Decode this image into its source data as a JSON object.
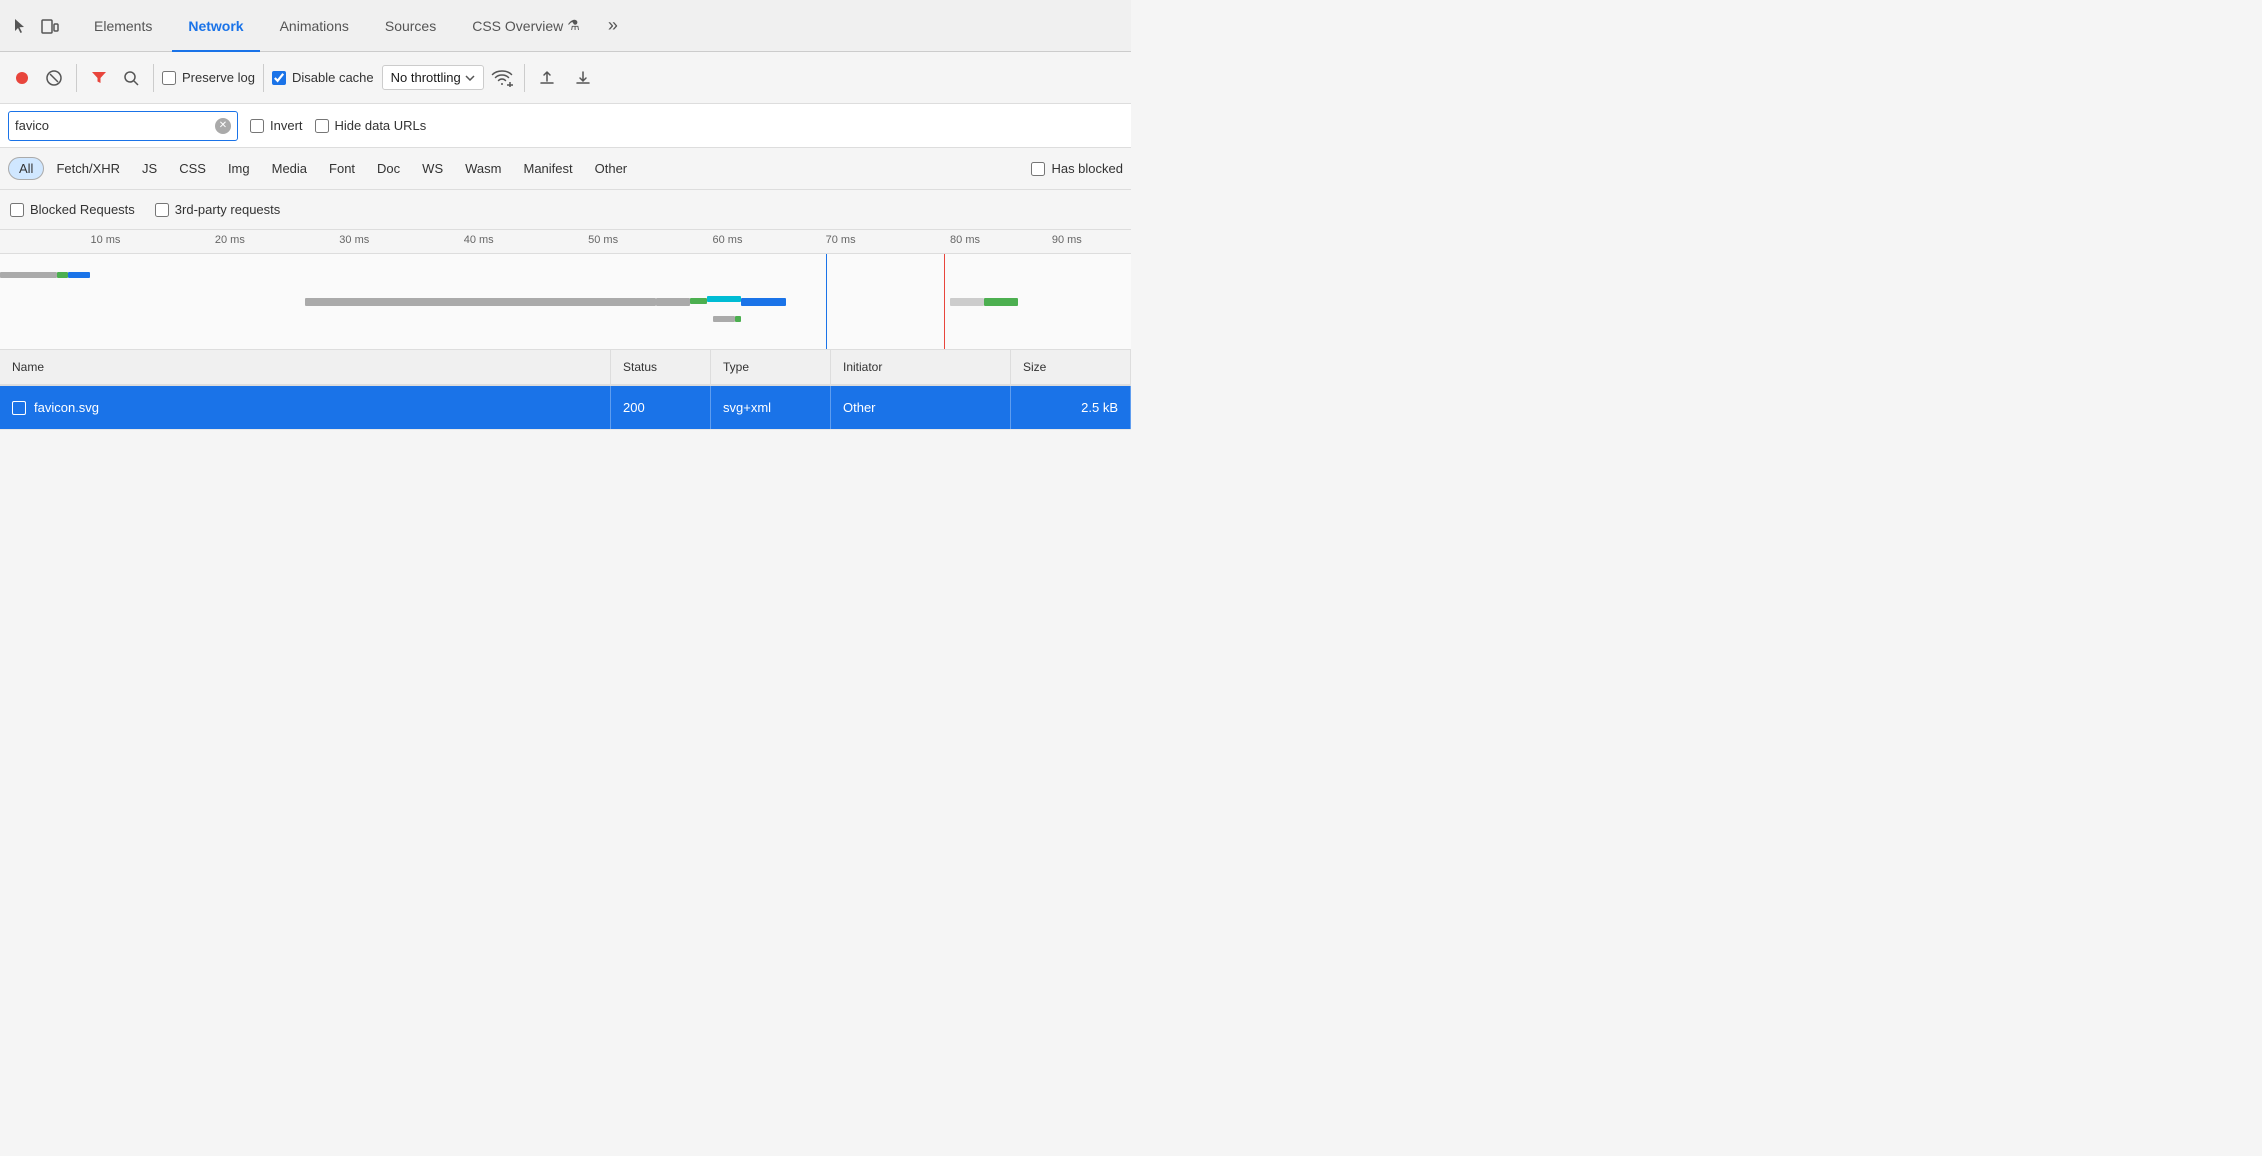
{
  "tabs": {
    "items": [
      {
        "label": "Elements",
        "active": false
      },
      {
        "label": "Network",
        "active": true
      },
      {
        "label": "Animations",
        "active": false
      },
      {
        "label": "Sources",
        "active": false
      },
      {
        "label": "CSS Overview",
        "active": false
      }
    ],
    "more_label": "»"
  },
  "toolbar": {
    "record_title": "Record",
    "stop_title": "Stop recording",
    "clear_title": "Clear",
    "filter_title": "Filter",
    "search_title": "Search",
    "preserve_log_label": "Preserve log",
    "disable_cache_label": "Disable cache",
    "no_throttling_label": "No throttling",
    "upload_title": "Upload",
    "download_title": "Download"
  },
  "search": {
    "value": "favico",
    "placeholder": "Filter",
    "invert_label": "Invert",
    "hide_data_urls_label": "Hide data URLs"
  },
  "filter_types": {
    "items": [
      {
        "label": "All",
        "active": true
      },
      {
        "label": "Fetch/XHR",
        "active": false
      },
      {
        "label": "JS",
        "active": false
      },
      {
        "label": "CSS",
        "active": false
      },
      {
        "label": "Img",
        "active": false
      },
      {
        "label": "Media",
        "active": false
      },
      {
        "label": "Font",
        "active": false
      },
      {
        "label": "Doc",
        "active": false
      },
      {
        "label": "WS",
        "active": false
      },
      {
        "label": "Wasm",
        "active": false
      },
      {
        "label": "Manifest",
        "active": false
      },
      {
        "label": "Other",
        "active": false
      }
    ],
    "has_blocked_label": "Has blocked"
  },
  "block_row": {
    "blocked_requests_label": "Blocked Requests",
    "third_party_label": "3rd-party requests"
  },
  "timeline": {
    "ticks": [
      {
        "label": "10 ms",
        "left_pct": 8
      },
      {
        "label": "20 ms",
        "left_pct": 19
      },
      {
        "label": "30 ms",
        "left_pct": 30
      },
      {
        "label": "40 ms",
        "left_pct": 41
      },
      {
        "label": "50 ms",
        "left_pct": 52
      },
      {
        "label": "60 ms",
        "left_pct": 63
      },
      {
        "label": "70 ms",
        "left_pct": 73
      },
      {
        "label": "80 ms",
        "left_pct": 84
      },
      {
        "label": "90 ms",
        "left_pct": 93
      }
    ]
  },
  "table": {
    "headers": [
      {
        "label": "Name",
        "col": "name-col"
      },
      {
        "label": "Status",
        "col": "status-col"
      },
      {
        "label": "Type",
        "col": "type-col"
      },
      {
        "label": "Initiator",
        "col": "initiator-col"
      },
      {
        "label": "Size",
        "col": "size-col"
      }
    ],
    "rows": [
      {
        "name": "favicon.svg",
        "status": "200",
        "type": "svg+xml",
        "initiator": "Other",
        "size": "2.5 kB",
        "selected": true
      }
    ]
  }
}
